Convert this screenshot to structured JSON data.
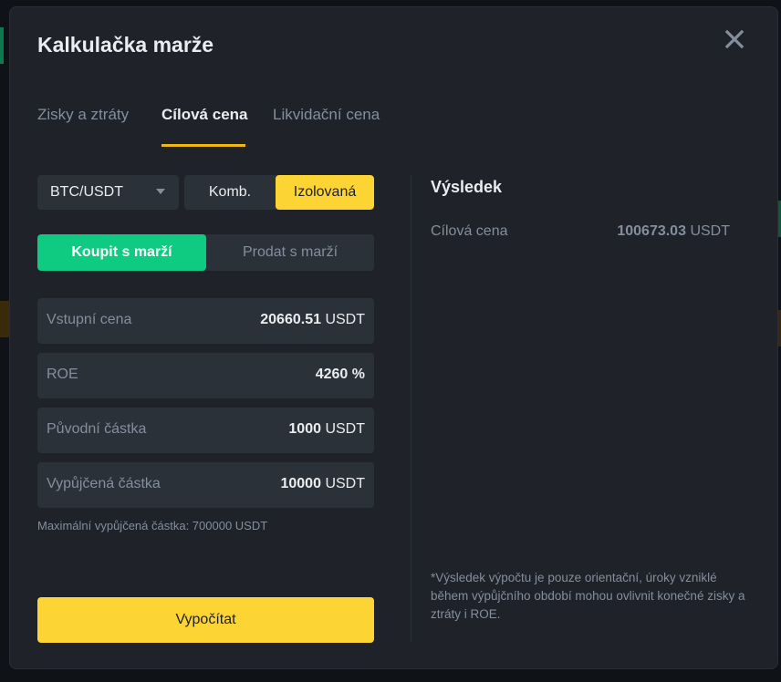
{
  "modal": {
    "title": "Kalkulačka marže",
    "close_icon": "close-icon"
  },
  "tabs": [
    {
      "label": "Zisky a ztráty",
      "active": false
    },
    {
      "label": "Cílová cena",
      "active": true
    },
    {
      "label": "Likvidační cena",
      "active": false
    }
  ],
  "form": {
    "pair": "BTC/USDT",
    "margin_modes": [
      "Komb.",
      "Izolovaná"
    ],
    "selected_margin_mode": "Izolovaná",
    "sides": [
      "Koupit s marží",
      "Prodat s marží"
    ],
    "selected_side": "Koupit s marží",
    "fields": [
      {
        "label": "Vstupní cena",
        "value": "20660.51",
        "unit": "USDT"
      },
      {
        "label": "ROE",
        "value": "4260",
        "unit": "%"
      },
      {
        "label": "Původní částka",
        "value": "1000",
        "unit": "USDT"
      },
      {
        "label": "Vypůjčená částka",
        "value": "10000",
        "unit": "USDT"
      }
    ],
    "max_borrow_note": "Maximální vypůjčená částka: 700000 USDT",
    "calculate_label": "Vypočítat"
  },
  "result": {
    "title": "Výsledek",
    "label": "Cílová cena",
    "value": "100673.03",
    "unit": "USDT",
    "disclaimer": "*Výsledek výpočtu je pouze orientační, úroky vzniklé během výpůjčního období mohou ovlivnit konečné zisky a ztráty i ROE."
  },
  "colors": {
    "accent_yellow": "#fcd535",
    "buy_green": "#0ecb81",
    "tab_underline": "#f0b90b",
    "modal_bg": "#1f2229",
    "field_bg": "#2b3139"
  }
}
